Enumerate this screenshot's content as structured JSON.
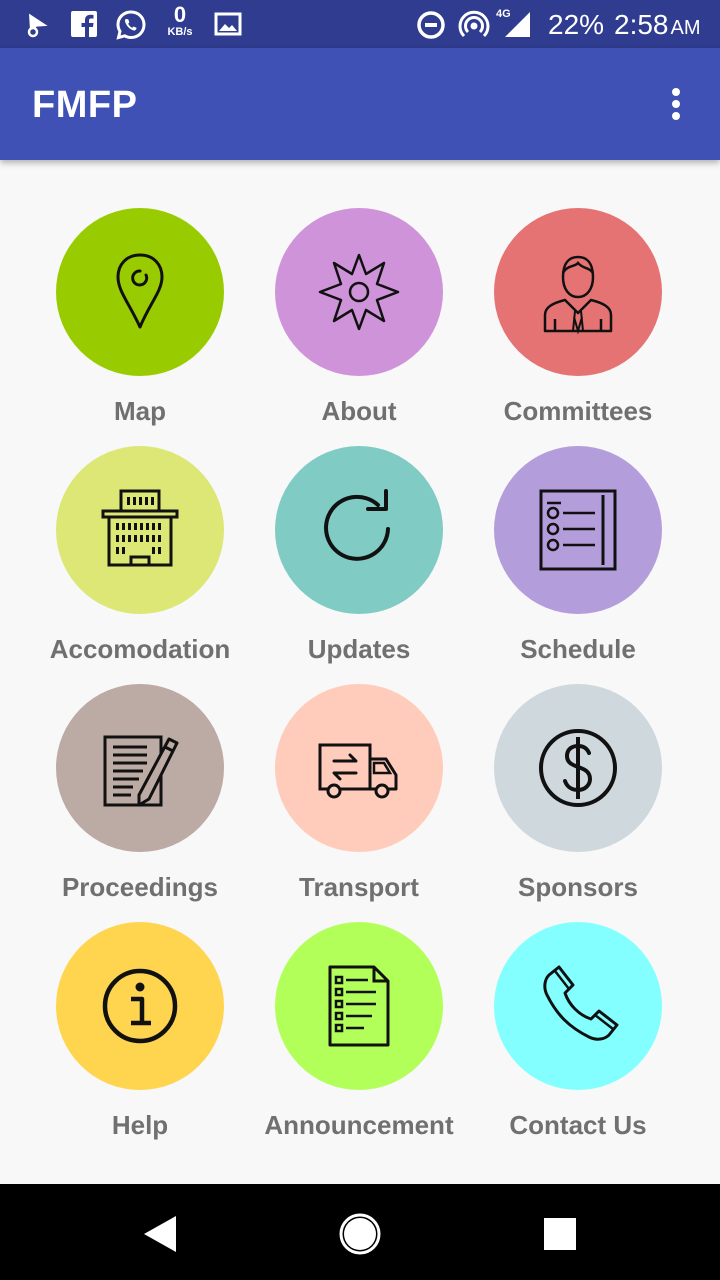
{
  "status_bar": {
    "speed_value": "0",
    "speed_unit": "KB/s",
    "network_label": "4G",
    "battery": "22%",
    "time": "2:58",
    "ampm": "AM"
  },
  "app_bar": {
    "title": "FMFP",
    "overflow_icon": "more-vert-icon"
  },
  "grid": {
    "items": [
      {
        "label": "Map",
        "icon": "map-pin-icon",
        "color": "#99cc00"
      },
      {
        "label": "About",
        "icon": "star-burst-icon",
        "color": "#ce93d8"
      },
      {
        "label": "Committees",
        "icon": "person-icon",
        "color": "#e57373"
      },
      {
        "label": "Accomodation",
        "icon": "hotel-icon",
        "color": "#dce775"
      },
      {
        "label": "Updates",
        "icon": "refresh-icon",
        "color": "#80cbc4"
      },
      {
        "label": "Schedule",
        "icon": "checklist-icon",
        "color": "#b39ddb"
      },
      {
        "label": "Proceedings",
        "icon": "document-pen-icon",
        "color": "#bcaaa4"
      },
      {
        "label": "Transport",
        "icon": "truck-icon",
        "color": "#ffccbc"
      },
      {
        "label": "Sponsors",
        "icon": "dollar-icon",
        "color": "#cfd8dc"
      },
      {
        "label": "Help",
        "icon": "info-icon",
        "color": "#ffd54f"
      },
      {
        "label": "Announcement",
        "icon": "list-document-icon",
        "color": "#b2ff59"
      },
      {
        "label": "Contact Us",
        "icon": "phone-icon",
        "color": "#84ffff"
      }
    ]
  },
  "nav_bar": {
    "back_icon": "back-icon",
    "home_icon": "home-icon",
    "recents_icon": "recents-icon"
  }
}
